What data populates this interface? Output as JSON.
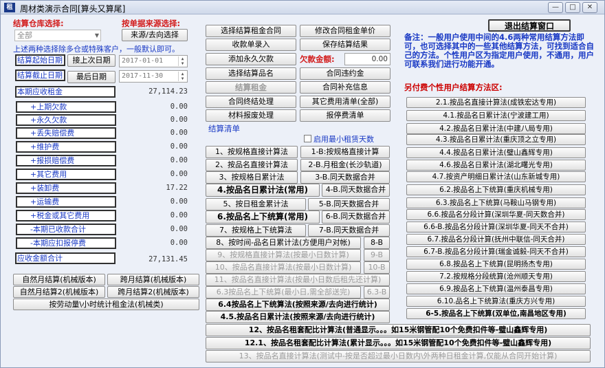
{
  "window": {
    "title": "周材类演示合同[算头又算尾]",
    "min": "—",
    "max": "□",
    "close": "✕",
    "app_icon": "租"
  },
  "left": {
    "warehouse_label": "结算仓库选择:",
    "source_label": "按单据来源选择:",
    "warehouse_value": "全部",
    "source_button": "来源/去向选择",
    "hint": "上述两种选择除多仓或特殊客户，一般默认即可。",
    "start_label": "结算起始日期",
    "start_btn": "接上次日期",
    "start_date": "2017-01-01",
    "end_label": "结算截止日期",
    "end_btn": "最后日期",
    "end_date": "2017-11-30",
    "rows": [
      {
        "label": "本期应收租金",
        "value": "27,114.23"
      },
      {
        "label": "+上期欠款",
        "value": "0.00"
      },
      {
        "label": "+永久欠款",
        "value": "0.00"
      },
      {
        "label": "+丢失赔偿费",
        "value": "0.00"
      },
      {
        "label": "+维护费",
        "value": "0.00"
      },
      {
        "label": "+报损赔偿费",
        "value": "0.00"
      },
      {
        "label": "+其它费用",
        "value": "0.00"
      },
      {
        "label": "+装卸费",
        "value": "17.22"
      },
      {
        "label": "+运输费",
        "value": "0.00"
      },
      {
        "label": "+税金或其它费用",
        "value": "0.00"
      },
      {
        "label": "-本期已收款合计",
        "value": "0.00"
      },
      {
        "label": "-本期应扣报停费",
        "value": "0.00"
      },
      {
        "label": "应收金额合计",
        "value": "27,131.45"
      }
    ],
    "buttons": [
      "自然月结算(机械版本)",
      "跨月结算(机械版本)",
      "自然月结算2(机械版本)",
      "跨月结算2(机械版本)",
      "按劳动量\\小时统计租金法(机械类)"
    ]
  },
  "mid": {
    "top_buttons": [
      "选择结算租金合同",
      "修改合同租金单价",
      "收款单录入",
      "保存结算结果",
      "添加永久欠款",
      "选择结算品名",
      "合同违约金",
      "结算租金",
      "合同补充信息",
      "合同终结处理",
      "其它费用清单(全部)",
      "材料报废处理",
      "报停费清单"
    ],
    "owed_label": "欠款金额:",
    "owed_value": "0.00",
    "section_title": "结算清单",
    "min_days_label": "启用最小租赁天数",
    "methods_left": [
      "1、按规格直接计算法",
      "2、按品名直接计算法",
      "3、按规格日累计法",
      "4.按品名日累计法(常用)",
      "5、按日租金累计法",
      "6.按品名上下统算(常用)",
      "7、按规格上下统算法"
    ],
    "methods_right": [
      "1-B:按规格直接计算",
      "2-B.月租金(长沙轨道)",
      "3-B.同天数据合并",
      "4-B.同天数据合并",
      "5-B.同天数据合并",
      "6-B.同天数据合并",
      "7-B.同天数据合并"
    ],
    "wide_methods": [
      "8、按时间-品名日累计法(方便用户对帐)",
      "9、按规格直接计算法(按最小日数计算)",
      "10、按品名直接计算法(按最小日数计算)",
      "11、按品名直接计算法(按最小日数后租先还计算)",
      "6.3按品名上下统算(最小日,需全部送完)",
      "6.4按品名上下统算法(按照来源/去向进行统计)",
      "4.5.按品名日累计法(按照来源/去向进行统计)"
    ],
    "wide_right": [
      "8-B",
      "9-B",
      "10-B",
      "6.3-B"
    ],
    "bottom_methods": [
      "12、按品名租套配比计算法(普通显示。。。如15米钢管配10个免费扣件等-璧山鑫辉专用)",
      "12.1、按品名租套配比计算法(累计显示。。。如15米钢管配10个免费扣件等-璧山鑫辉专用)",
      "13、按品名直接计算法(测试中-按是否超过最小日数内\\外两种日租金计算,仅能从合同开始计算)"
    ]
  },
  "right": {
    "exit_button": "退出结算窗口",
    "note": "备注：一般用户使用中间的4.6两种常用结算方法即可，也可选择其中的一些其他结算方法，可找到适合自己的方法。个性用户区为指定用户使用，不通用，用户可联系我们进行功能开通。",
    "custom_title": "另付费个性用户结算方法区:",
    "custom_buttons": [
      "2.1.按品名直接计算法(成铁宏达专用)",
      "4.1.按品名日累计法(宁波建工用)",
      "4.2.按品名日累计法(中建八局专用)",
      "4.3.按品名日累计法(重庆顶之立专用)",
      "4.4.按品名日累计法(璧山鑫辉专用)",
      "4.6.按品名日累计法(湖北曙光专用)",
      "4.7.按资产明细日累计法(山东新城专用)",
      "6.2.按品名上下统算(重庆机械专用)",
      "6.3.按品名上下统算(马鞍山马钢专用)",
      "6.6.按品名分段计算(深圳华夏-同天数合并)",
      "6.6-B.按品名分段计算(深圳华夏-同天不合并)",
      "6.7.按品名分段计算(抚州中联信-同天合并)",
      "6.7-B.按品名分段计算(瑞金诚毅-同天不合并)",
      "6.8.按品名上下统算(昆明扬杰专用)",
      "7.2.按规格分段统算(沧州顺天专用)",
      "6.9.按品名上下统算(温州泰昌专用)",
      "6.10.品名上下统算法(重庆方兴专用)",
      "6-5.按品名上下统算(双单位,南昌地区专用)"
    ]
  },
  "colors": {
    "accent_blue": "#1838c4",
    "accent_red": "#d21b1b"
  }
}
